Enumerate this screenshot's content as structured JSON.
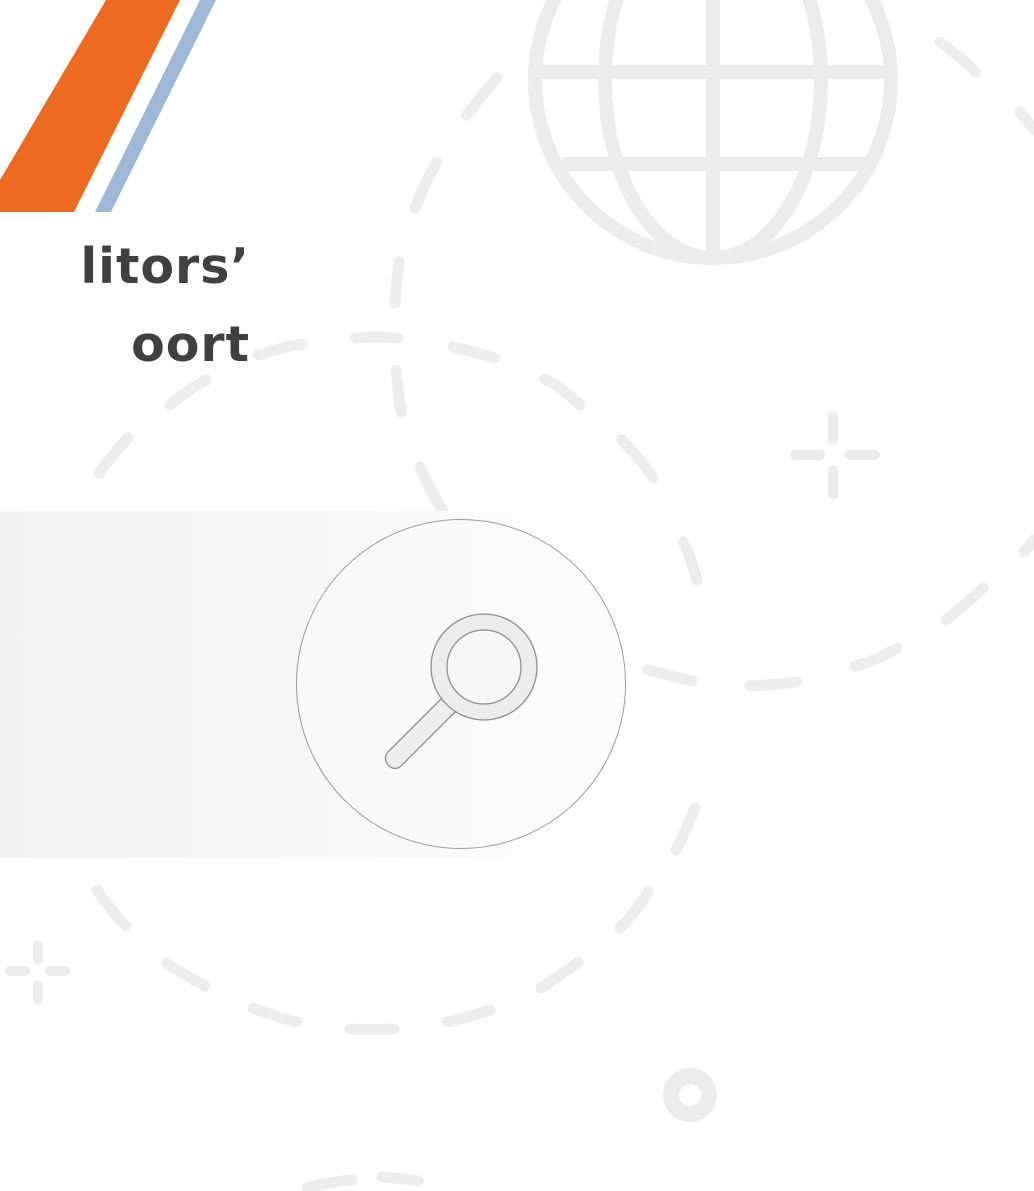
{
  "title": {
    "line1": "litors’",
    "line2": "oort"
  },
  "colors": {
    "accent_orange": "#ec6a21",
    "accent_blue": "#9fb8d6",
    "title_text": "#404040",
    "decor_gray": "#ececec"
  },
  "icons": {
    "magnifier": "magnifying-glass-icon",
    "globe": "globe-icon"
  }
}
